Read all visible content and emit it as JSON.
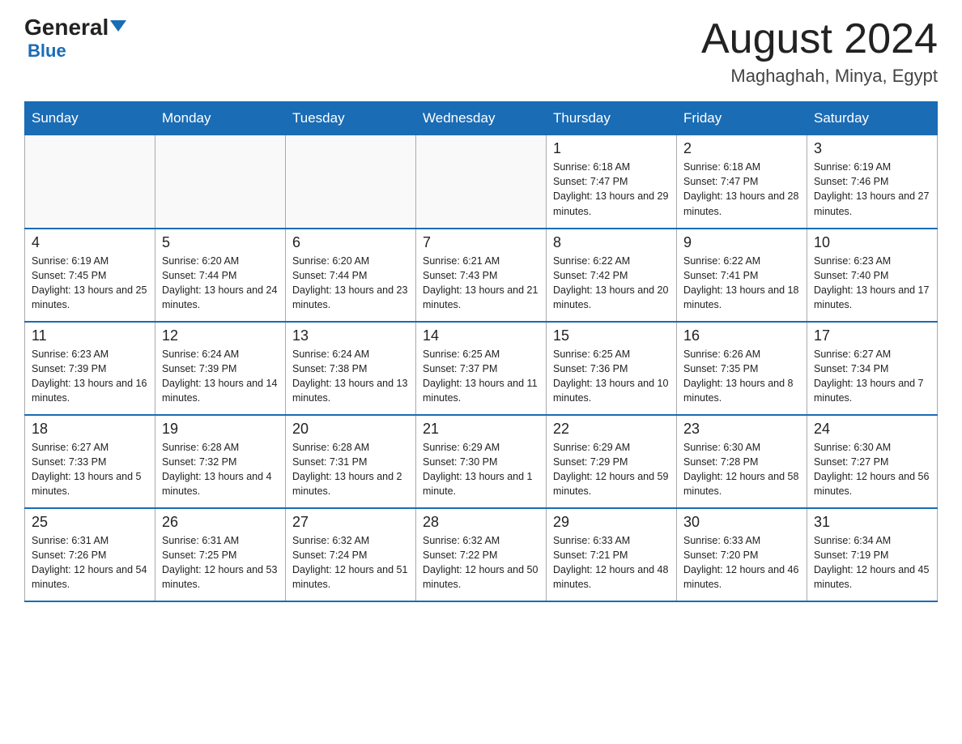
{
  "header": {
    "logo_general": "General",
    "logo_blue": "Blue",
    "title": "August 2024",
    "subtitle": "Maghaghah, Minya, Egypt"
  },
  "weekdays": [
    "Sunday",
    "Monday",
    "Tuesday",
    "Wednesday",
    "Thursday",
    "Friday",
    "Saturday"
  ],
  "weeks": [
    [
      {
        "day": "",
        "info": ""
      },
      {
        "day": "",
        "info": ""
      },
      {
        "day": "",
        "info": ""
      },
      {
        "day": "",
        "info": ""
      },
      {
        "day": "1",
        "info": "Sunrise: 6:18 AM\nSunset: 7:47 PM\nDaylight: 13 hours and 29 minutes."
      },
      {
        "day": "2",
        "info": "Sunrise: 6:18 AM\nSunset: 7:47 PM\nDaylight: 13 hours and 28 minutes."
      },
      {
        "day": "3",
        "info": "Sunrise: 6:19 AM\nSunset: 7:46 PM\nDaylight: 13 hours and 27 minutes."
      }
    ],
    [
      {
        "day": "4",
        "info": "Sunrise: 6:19 AM\nSunset: 7:45 PM\nDaylight: 13 hours and 25 minutes."
      },
      {
        "day": "5",
        "info": "Sunrise: 6:20 AM\nSunset: 7:44 PM\nDaylight: 13 hours and 24 minutes."
      },
      {
        "day": "6",
        "info": "Sunrise: 6:20 AM\nSunset: 7:44 PM\nDaylight: 13 hours and 23 minutes."
      },
      {
        "day": "7",
        "info": "Sunrise: 6:21 AM\nSunset: 7:43 PM\nDaylight: 13 hours and 21 minutes."
      },
      {
        "day": "8",
        "info": "Sunrise: 6:22 AM\nSunset: 7:42 PM\nDaylight: 13 hours and 20 minutes."
      },
      {
        "day": "9",
        "info": "Sunrise: 6:22 AM\nSunset: 7:41 PM\nDaylight: 13 hours and 18 minutes."
      },
      {
        "day": "10",
        "info": "Sunrise: 6:23 AM\nSunset: 7:40 PM\nDaylight: 13 hours and 17 minutes."
      }
    ],
    [
      {
        "day": "11",
        "info": "Sunrise: 6:23 AM\nSunset: 7:39 PM\nDaylight: 13 hours and 16 minutes."
      },
      {
        "day": "12",
        "info": "Sunrise: 6:24 AM\nSunset: 7:39 PM\nDaylight: 13 hours and 14 minutes."
      },
      {
        "day": "13",
        "info": "Sunrise: 6:24 AM\nSunset: 7:38 PM\nDaylight: 13 hours and 13 minutes."
      },
      {
        "day": "14",
        "info": "Sunrise: 6:25 AM\nSunset: 7:37 PM\nDaylight: 13 hours and 11 minutes."
      },
      {
        "day": "15",
        "info": "Sunrise: 6:25 AM\nSunset: 7:36 PM\nDaylight: 13 hours and 10 minutes."
      },
      {
        "day": "16",
        "info": "Sunrise: 6:26 AM\nSunset: 7:35 PM\nDaylight: 13 hours and 8 minutes."
      },
      {
        "day": "17",
        "info": "Sunrise: 6:27 AM\nSunset: 7:34 PM\nDaylight: 13 hours and 7 minutes."
      }
    ],
    [
      {
        "day": "18",
        "info": "Sunrise: 6:27 AM\nSunset: 7:33 PM\nDaylight: 13 hours and 5 minutes."
      },
      {
        "day": "19",
        "info": "Sunrise: 6:28 AM\nSunset: 7:32 PM\nDaylight: 13 hours and 4 minutes."
      },
      {
        "day": "20",
        "info": "Sunrise: 6:28 AM\nSunset: 7:31 PM\nDaylight: 13 hours and 2 minutes."
      },
      {
        "day": "21",
        "info": "Sunrise: 6:29 AM\nSunset: 7:30 PM\nDaylight: 13 hours and 1 minute."
      },
      {
        "day": "22",
        "info": "Sunrise: 6:29 AM\nSunset: 7:29 PM\nDaylight: 12 hours and 59 minutes."
      },
      {
        "day": "23",
        "info": "Sunrise: 6:30 AM\nSunset: 7:28 PM\nDaylight: 12 hours and 58 minutes."
      },
      {
        "day": "24",
        "info": "Sunrise: 6:30 AM\nSunset: 7:27 PM\nDaylight: 12 hours and 56 minutes."
      }
    ],
    [
      {
        "day": "25",
        "info": "Sunrise: 6:31 AM\nSunset: 7:26 PM\nDaylight: 12 hours and 54 minutes."
      },
      {
        "day": "26",
        "info": "Sunrise: 6:31 AM\nSunset: 7:25 PM\nDaylight: 12 hours and 53 minutes."
      },
      {
        "day": "27",
        "info": "Sunrise: 6:32 AM\nSunset: 7:24 PM\nDaylight: 12 hours and 51 minutes."
      },
      {
        "day": "28",
        "info": "Sunrise: 6:32 AM\nSunset: 7:22 PM\nDaylight: 12 hours and 50 minutes."
      },
      {
        "day": "29",
        "info": "Sunrise: 6:33 AM\nSunset: 7:21 PM\nDaylight: 12 hours and 48 minutes."
      },
      {
        "day": "30",
        "info": "Sunrise: 6:33 AM\nSunset: 7:20 PM\nDaylight: 12 hours and 46 minutes."
      },
      {
        "day": "31",
        "info": "Sunrise: 6:34 AM\nSunset: 7:19 PM\nDaylight: 12 hours and 45 minutes."
      }
    ]
  ]
}
